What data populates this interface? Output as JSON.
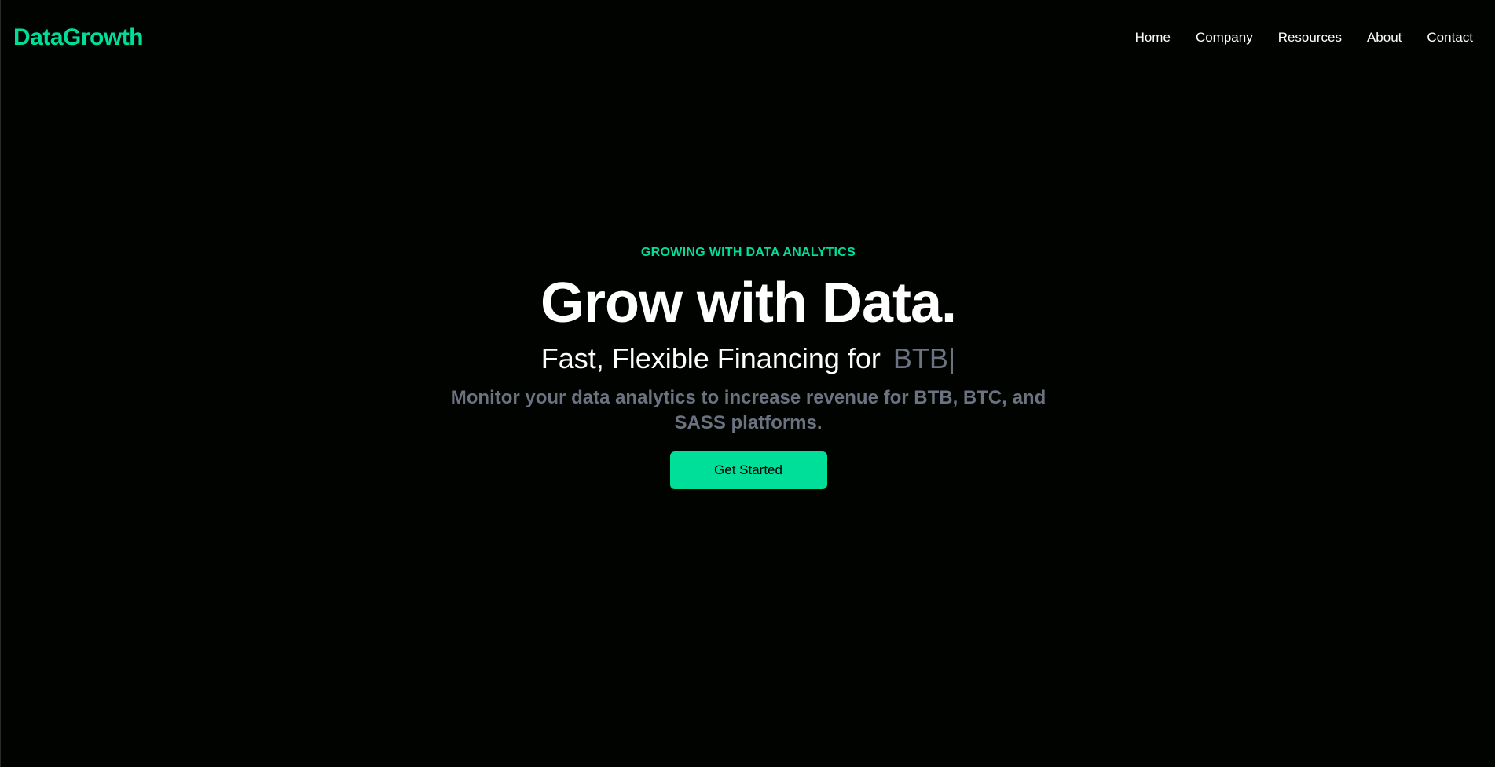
{
  "brand": {
    "name": "DataGrowth",
    "accent_color": "#00df9a"
  },
  "nav": {
    "items": [
      "Home",
      "Company",
      "Resources",
      "About",
      "Contact"
    ]
  },
  "hero": {
    "eyebrow": "GROWING WITH DATA ANALYTICS",
    "headline": "Grow with Data.",
    "tagline": "Fast, Flexible Financing for",
    "rotating_word": "BTB",
    "cursor": "|",
    "subtext": "Monitor your data analytics to increase revenue for BTB, BTC, and SASS platforms.",
    "cta_label": "Get Started"
  },
  "colors": {
    "background": "#000300",
    "text_primary": "#ffffff",
    "text_muted": "#6b7280"
  }
}
